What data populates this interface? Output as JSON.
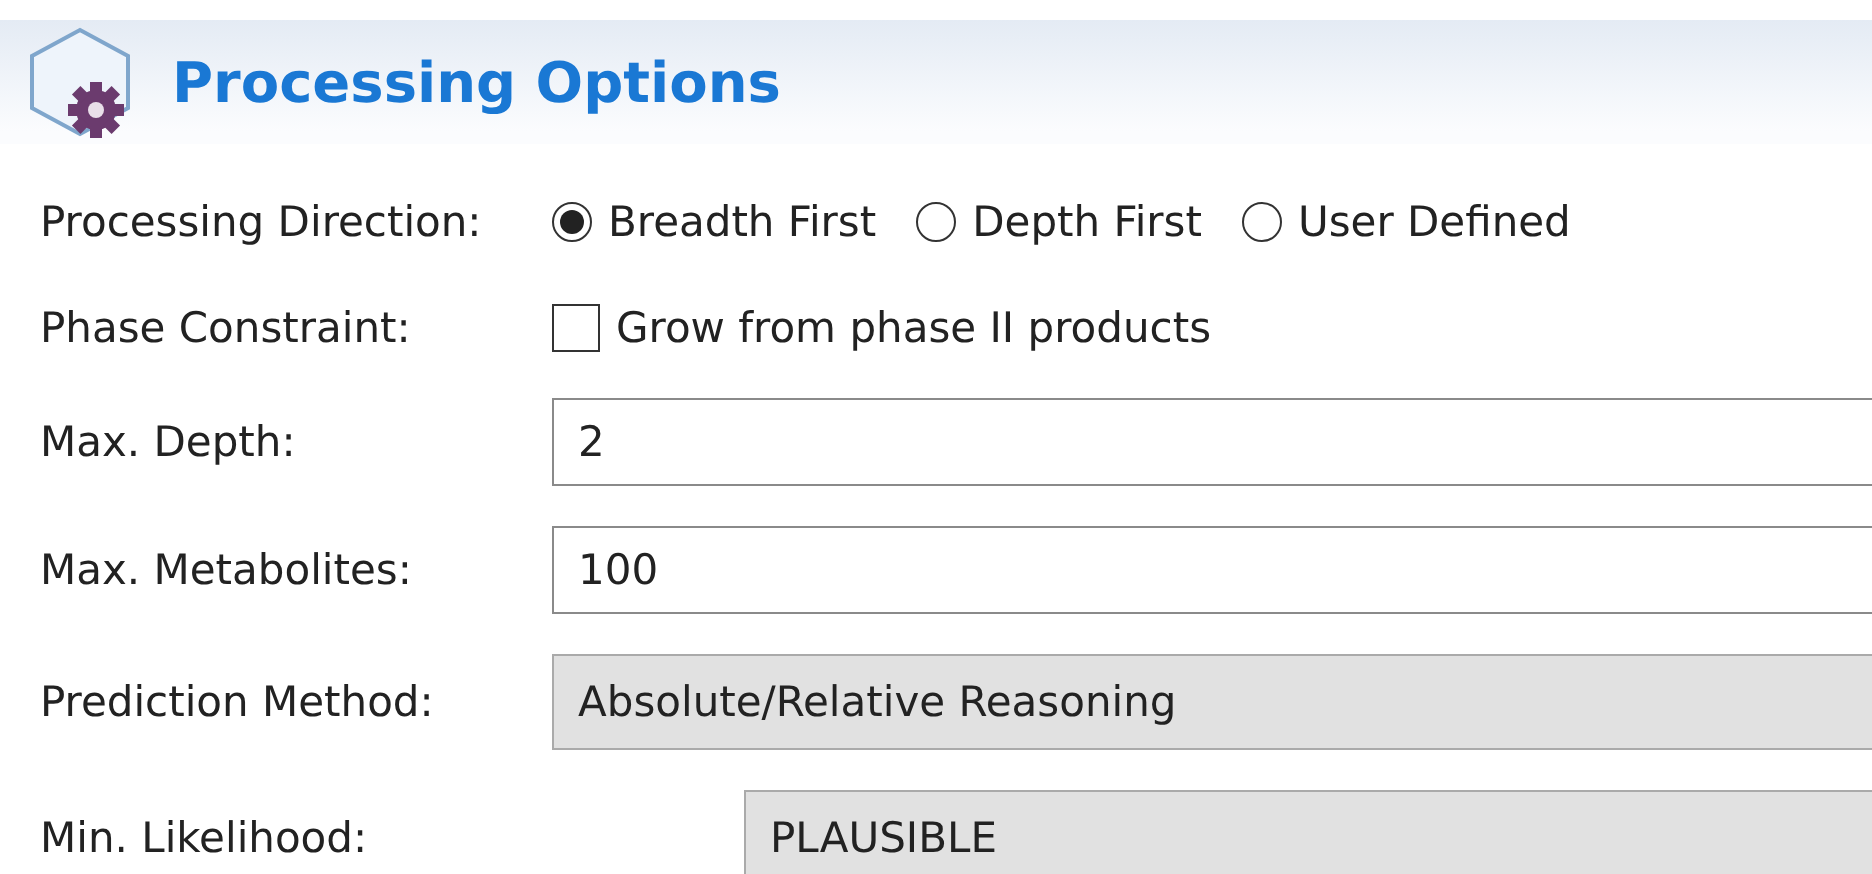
{
  "header": {
    "title": "Processing Options"
  },
  "rows": [
    {
      "kind": "radio",
      "label": "Processing Direction:",
      "options": [
        {
          "label": "Breadth First",
          "selected": true
        },
        {
          "label": "Depth First",
          "selected": false
        },
        {
          "label": "User Defined",
          "selected": false
        }
      ]
    },
    {
      "kind": "checkbox",
      "label": "Phase Constraint:",
      "option": {
        "label": "Grow from phase II products",
        "checked": false
      }
    },
    {
      "kind": "field",
      "label": "Max. Depth:",
      "value": "2",
      "disabled": false
    },
    {
      "kind": "field",
      "label": "Max. Metabolites:",
      "value": "100",
      "disabled": false
    },
    {
      "kind": "field",
      "label": "Prediction Method:",
      "value": "Absolute/Relative Reasoning",
      "disabled": true
    },
    {
      "kind": "field",
      "label": "Min. Likelihood:",
      "value": "PLAUSIBLE",
      "disabled": true
    }
  ]
}
